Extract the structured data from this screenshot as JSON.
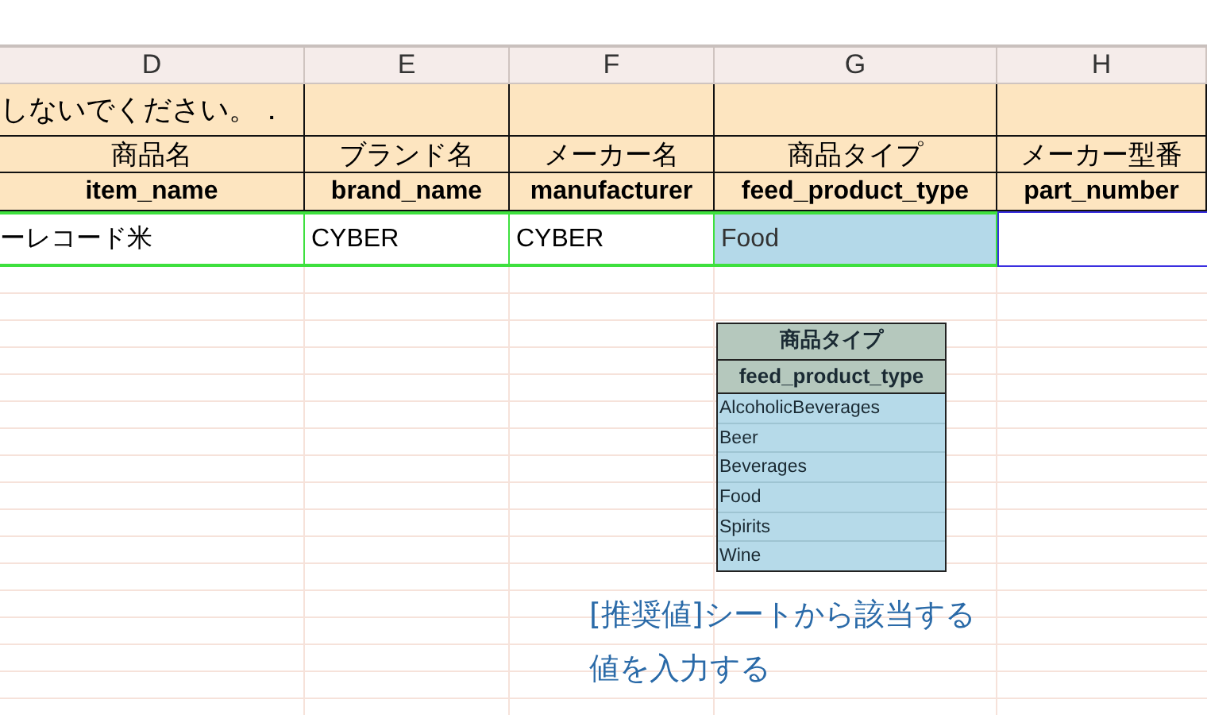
{
  "column_letters": [
    "D",
    "E",
    "F",
    "G",
    "H"
  ],
  "notice_row": {
    "text": "しないでください。．"
  },
  "label_row": [
    "商品名",
    "ブランド名",
    "メーカー名",
    "商品タイプ",
    "メーカー型番"
  ],
  "field_row": [
    "item_name",
    "brand_name",
    "manufacturer",
    "feed_product_type",
    "part_number"
  ],
  "data_row": [
    {
      "value": "ーレコード米",
      "highlighted": false,
      "selected": false
    },
    {
      "value": "CYBER",
      "highlighted": false,
      "selected": false
    },
    {
      "value": "CYBER",
      "highlighted": false,
      "selected": false
    },
    {
      "value": "Food",
      "highlighted": true,
      "selected": false
    },
    {
      "selected": true,
      "highlighted": false
    }
  ],
  "lookup_table": {
    "title": "商品タイプ",
    "field": "feed_product_type",
    "options": [
      "AlcoholicBeverages",
      "Beer",
      "Beverages",
      "Food",
      "Spirits",
      "Wine"
    ]
  },
  "note": {
    "lines": [
      "[推奨値]シートから該当する",
      "値を入力する"
    ]
  }
}
